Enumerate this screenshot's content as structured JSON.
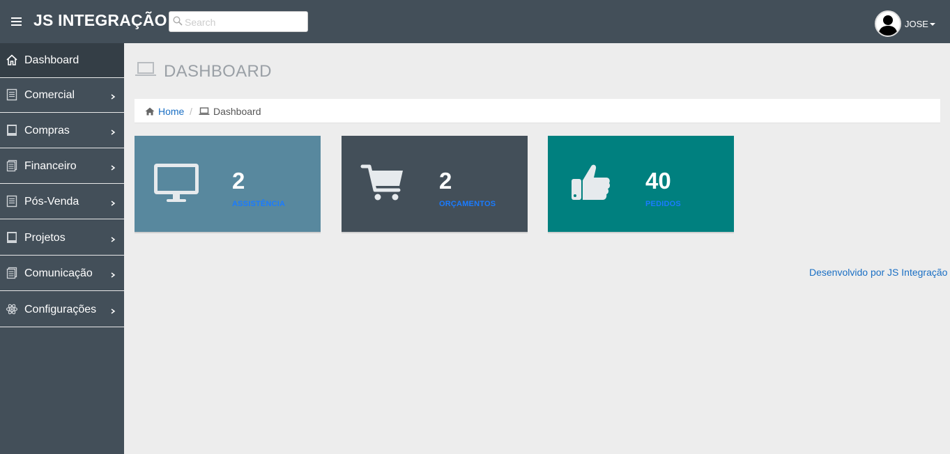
{
  "header": {
    "brand": "JS INTEGRAÇÃO",
    "search": {
      "placeholder": "Search",
      "value": ""
    },
    "user": {
      "name": "JOSE"
    },
    "colors": {
      "topbar": "#434f59"
    }
  },
  "sidebar": {
    "items": [
      {
        "label": "Dashboard",
        "icon": "home-icon"
      },
      {
        "label": "Comercial",
        "icon": "list-icon"
      },
      {
        "label": "Compras",
        "icon": "book-icon"
      },
      {
        "label": "Financeiro",
        "icon": "stack-icon"
      },
      {
        "label": "Pós-Venda",
        "icon": "list-icon"
      },
      {
        "label": "Projetos",
        "icon": "book-icon"
      },
      {
        "label": "Comunicação",
        "icon": "stack-icon"
      },
      {
        "label": "Configurações",
        "icon": "atom-icon"
      }
    ]
  },
  "main": {
    "title": "DASHBOARD",
    "breadcrumb": {
      "home": "Home",
      "separator": "/",
      "current": "Dashboard"
    },
    "cards": [
      {
        "value": "2",
        "label": "ASSISTÊNCIA",
        "icon": "monitor-icon",
        "color": "#58889e"
      },
      {
        "value": "2",
        "label": "ORÇAMENTOS",
        "icon": "cart-icon",
        "color": "#434f59"
      },
      {
        "value": "40",
        "label": "PEDIDOS",
        "icon": "thumbs-up-icon",
        "color": "#00807f"
      }
    ],
    "footer": "Desenvolvido por JS Integração"
  }
}
